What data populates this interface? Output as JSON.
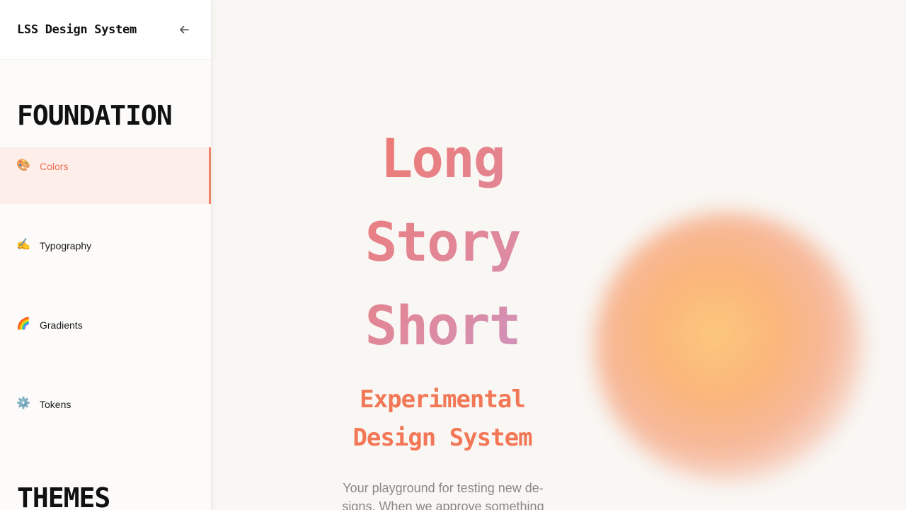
{
  "sidebar": {
    "app_title": "LSS Design System",
    "collapse_icon": "arrow-left-icon",
    "sections": [
      {
        "title": "FOUNDATION",
        "items": [
          {
            "label": "Colors",
            "icon": "🎨",
            "active": true
          },
          {
            "label": "Typography",
            "icon": "✍️",
            "active": false
          },
          {
            "label": "Gradients",
            "icon": "🌈",
            "active": false
          },
          {
            "label": "Tokens",
            "icon": "⚙️",
            "active": false
          }
        ]
      },
      {
        "title": "THEMES",
        "items": []
      }
    ]
  },
  "hero": {
    "title_lines": [
      "Long",
      "Story",
      "Short"
    ],
    "subtitle_lines": [
      "Experimental",
      "Design System"
    ],
    "description": "Your playground for testing new de-signs. When we approve something"
  },
  "colors": {
    "accent": "#ee6f52",
    "active_bg": "#fdeeea",
    "title_gradient_start": "#f0776d",
    "title_gradient_end": "#c49ad0",
    "blob": "#fcc97e"
  }
}
